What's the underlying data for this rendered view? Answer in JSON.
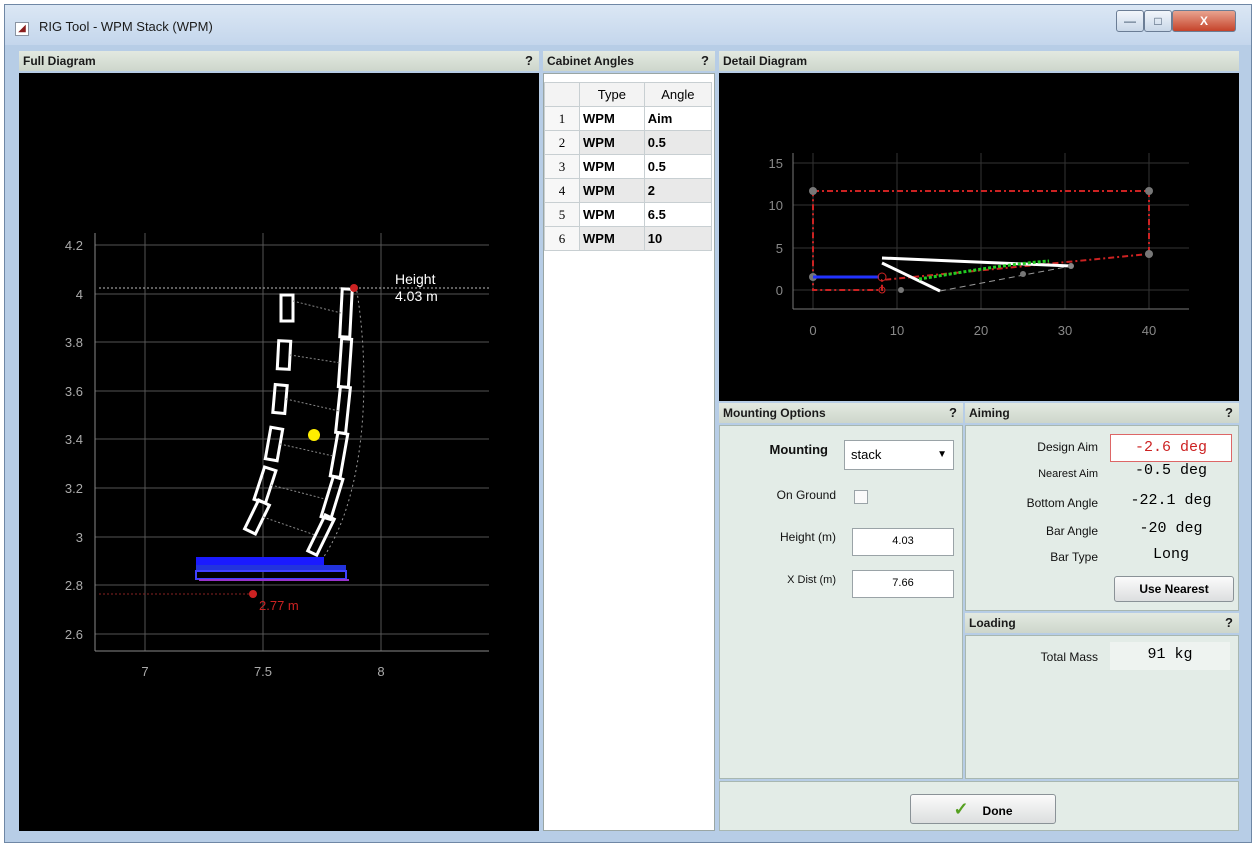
{
  "window": {
    "title": "RIG Tool - WPM Stack (WPM)",
    "app_icon": "matlab-figure-icon",
    "controls": {
      "minimize": "—",
      "maximize": "□",
      "close": "X"
    }
  },
  "full_diagram": {
    "header": "Full Diagram",
    "help": "?",
    "y_ticks": [
      "4.2",
      "4",
      "3.8",
      "3.6",
      "3.4",
      "3.2",
      "3",
      "2.8",
      "2.6"
    ],
    "x_ticks": [
      "7",
      "7.5",
      "8"
    ],
    "height_label_1": "Height",
    "height_label_2": "4.03 m",
    "bottom_label": "2.77 m",
    "colors": {
      "cabinet": "#ffffff",
      "base": "#1a1aff",
      "marker": "#cc2222",
      "center": "#ffee00"
    }
  },
  "cabinet_angles": {
    "header": "Cabinet Angles",
    "help": "?",
    "columns": [
      "Type",
      "Angle"
    ],
    "rows": [
      {
        "n": "1",
        "type": "WPM",
        "angle": "Aim"
      },
      {
        "n": "2",
        "type": "WPM",
        "angle": "0.5"
      },
      {
        "n": "3",
        "type": "WPM",
        "angle": "0.5"
      },
      {
        "n": "4",
        "type": "WPM",
        "angle": "2"
      },
      {
        "n": "5",
        "type": "WPM",
        "angle": "6.5"
      },
      {
        "n": "6",
        "type": "WPM",
        "angle": "10"
      }
    ]
  },
  "detail_diagram": {
    "header": "Detail Diagram",
    "y_ticks": [
      "15",
      "10",
      "5",
      "0"
    ],
    "x_ticks": [
      "0",
      "10",
      "20",
      "30",
      "40"
    ]
  },
  "mounting_options": {
    "header": "Mounting Options",
    "help": "?",
    "mounting_label": "Mounting",
    "mounting_value": "stack",
    "on_ground_label": "On Ground",
    "height_label": "Height (m)",
    "height_value": "4.03",
    "xdist_label": "X Dist (m)",
    "xdist_value": "7.66"
  },
  "aiming": {
    "header": "Aiming",
    "help": "?",
    "design_aim_label": "Design Aim",
    "design_aim_value": "-2.6 deg",
    "nearest_aim_label": "Nearest Aim",
    "nearest_aim_value": "-0.5 deg",
    "bottom_angle_label": "Bottom Angle",
    "bottom_angle_value": "-22.1 deg",
    "bar_angle_label": "Bar Angle",
    "bar_angle_value": "-20 deg",
    "bar_type_label": "Bar Type",
    "bar_type_value": "Long",
    "use_nearest_label": "Use Nearest"
  },
  "loading": {
    "header": "Loading",
    "help": "?",
    "total_mass_label": "Total Mass",
    "total_mass_value": "91 kg"
  },
  "done_label": "Done"
}
